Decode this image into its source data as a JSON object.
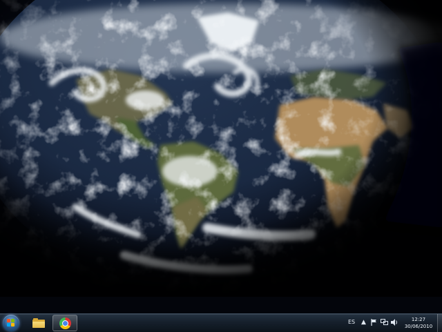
{
  "desktop": {
    "wallpaper_icon": "earth-satellite-wallpaper",
    "colors": {
      "ocean": "#1b2a44",
      "land_desert": "#b59060",
      "land_green": "#56673c",
      "cloud": "#e8edf2",
      "night": "#03050b"
    }
  },
  "taskbar": {
    "start_icon": "windows-orb-icon",
    "pinned": [
      {
        "name": "windows-explorer",
        "icon": "folder-icon",
        "active": false
      },
      {
        "name": "google-chrome",
        "icon": "chrome-icon",
        "active": true
      }
    ],
    "tray": {
      "language": "ES",
      "icons": [
        "show-hidden-icons-arrow",
        "action-center-flag-icon",
        "network-icon",
        "volume-icon"
      ]
    },
    "clock": {
      "time": "12:27",
      "date": "30/06/2010"
    }
  }
}
